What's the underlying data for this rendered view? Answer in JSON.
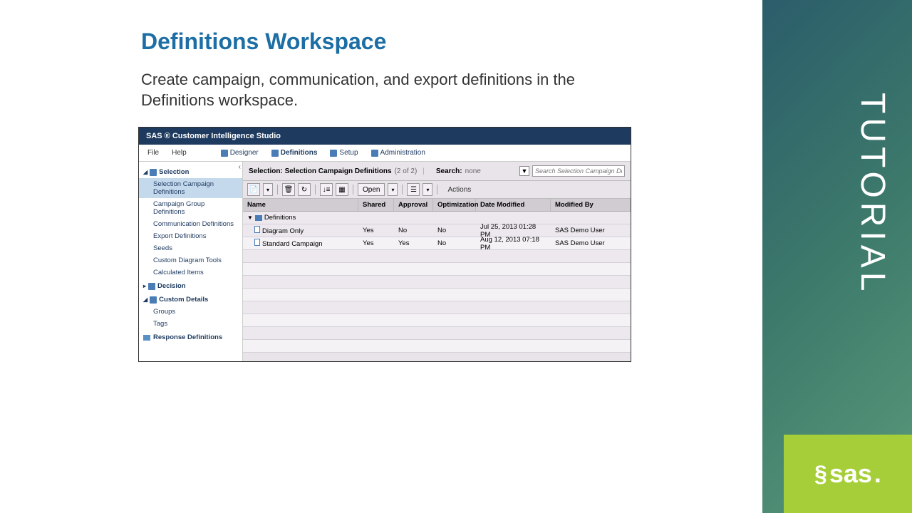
{
  "slide": {
    "title": "Definitions Workspace",
    "subtitle": "Create campaign, communication, and export definitions in the Definitions workspace."
  },
  "right": {
    "tutorial": "TUTORIAL",
    "logo": "sas"
  },
  "app": {
    "title": "SAS ®  Customer Intelligence Studio",
    "menu": {
      "file": "File",
      "help": "Help",
      "designer": "Designer",
      "definitions": "Definitions",
      "setup": "Setup",
      "admin": "Administration"
    },
    "sidebar": {
      "selection": {
        "label": "Selection",
        "items": [
          "Selection Campaign Definitions",
          "Campaign Group Definitions",
          "Communication Definitions",
          "Export Definitions",
          "Seeds",
          "Custom Diagram Tools",
          "Calculated Items"
        ]
      },
      "decision": {
        "label": "Decision"
      },
      "custom": {
        "label": "Custom Details",
        "items": [
          "Groups",
          "Tags"
        ]
      },
      "response": {
        "label": "Response Definitions"
      }
    },
    "header": {
      "selLabel": "Selection: Selection Campaign Definitions",
      "count": "(2 of 2)",
      "searchLabel": "Search:",
      "searchVal": "none",
      "searchPlaceholder": "Search Selection Campaign Defi..."
    },
    "toolbar": {
      "open": "Open",
      "actions": "Actions"
    },
    "cols": {
      "name": "Name",
      "shared": "Shared",
      "approval": "Approval",
      "opt": "Optimization",
      "date": "Date Modified",
      "modby": "Modified By"
    },
    "folder": "Definitions",
    "rows": [
      {
        "name": "Diagram Only",
        "shared": "Yes",
        "approval": "No",
        "opt": "No",
        "date": "Jul 25, 2013 01:28 PM",
        "modby": "SAS Demo User"
      },
      {
        "name": "Standard Campaign",
        "shared": "Yes",
        "approval": "Yes",
        "opt": "No",
        "date": "Aug 12, 2013 07:18 PM",
        "modby": "SAS Demo User"
      }
    ]
  }
}
